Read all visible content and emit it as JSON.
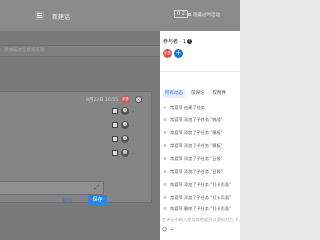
{
  "header": {
    "title": "新建话",
    "count_badge": "0 2",
    "right_text": "隐藏过时活动"
  },
  "main": {
    "placeholder": "添加描述信息或实验",
    "row_date": "8月22日 16:55",
    "user_badge": "乐多",
    "row_close": "×",
    "chevron": "›",
    "editor_resize": "⤢",
    "cancel_label": "取消",
    "save_label": "保存"
  },
  "sidebar": {
    "participants_label": "参与者 · 1",
    "help_icon": "?",
    "participant_avatar": "乐多",
    "add_participant": "+",
    "tabs": [
      {
        "label": "所有动态",
        "active": true
      },
      {
        "label": "仅评论",
        "active": false
      },
      {
        "label": "仅附件",
        "active": false
      }
    ],
    "activities": [
      {
        "icon": "+",
        "text": "常渡萍 创建了任务"
      },
      {
        "icon": "≡",
        "text": "常渡萍 添加了子任务 \"挑战\""
      },
      {
        "icon": "≡",
        "text": "常渡萍 添加了子任务 \"模板\""
      },
      {
        "icon": "≡",
        "text": "常渡萍 添加了子任务 \"模板\""
      },
      {
        "icon": "≡",
        "text": "常渡萍 添加了子任务 \"日报\""
      },
      {
        "icon": "≡",
        "text": "常渡萍 添加了子任务 \"日报\""
      },
      {
        "icon": "≡",
        "text": "常渡萍 添加了子任务 \"打卡页面\""
      },
      {
        "icon": "≡",
        "text": "常渡萍 添加了子任务 \"打卡页面\""
      },
      {
        "icon": "≡",
        "text": "常渡萍 删除了子任务 \"打卡页面\""
      }
    ],
    "comment_placeholder": "在评论中输入提及其他成员以通知对方, 按Enter",
    "bottom_icons": [
      "☺",
      "⌁"
    ]
  }
}
